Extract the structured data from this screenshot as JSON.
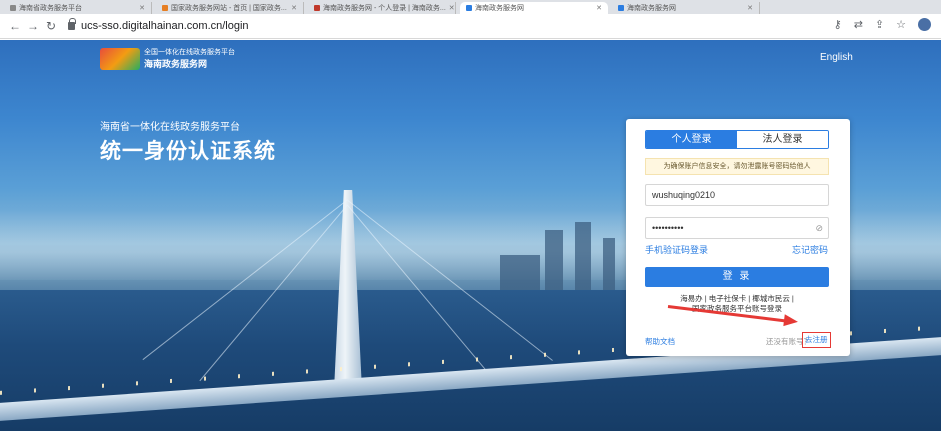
{
  "browser": {
    "tabs": [
      {
        "label": "海南省政务服务平台",
        "active": false
      },
      {
        "label": "国家政务服务网站 - 首页 | 国家政务...",
        "active": false
      },
      {
        "label": "海南政务服务网 - 个人登录 | 海南政务...",
        "active": false
      },
      {
        "label": "海南政务服务网",
        "active": true
      },
      {
        "label": "海南政务服务网",
        "active": false
      }
    ],
    "url": "ucs-sso.digitalhainan.com.cn/login",
    "back_icon": "back-arrow-icon",
    "forward_icon": "forward-arrow-icon",
    "reload_icon": "reload-icon"
  },
  "header": {
    "logo_line1": "全国一体化在线政务服务平台",
    "logo_line2": "海南政务服务网",
    "language": "English"
  },
  "hero": {
    "subtitle": "海南省一体化在线政务服务平台",
    "title": "统一身份认证系统"
  },
  "login": {
    "tabs": [
      {
        "label": "个人登录",
        "active": true
      },
      {
        "label": "法人登录",
        "active": false
      }
    ],
    "notice": "为确保账户信息安全，请勿泄露账号密码给他人",
    "username_value": "wushuqing0210",
    "password_value": "••••••••••",
    "sms_login_link": "手机验证码登录",
    "forgot_password_link": "忘记密码",
    "login_button": "登 录",
    "alt_login_line1": "海易办 | 电子社保卡 | 椰城市民云 |",
    "alt_login_line2": "国家政务服务平台账号登录",
    "help_link": "帮助文档",
    "no_account_text": "还没有账号？",
    "register_link": "去注册"
  },
  "colors": {
    "accent": "#2b7de1",
    "highlight": "#e53935"
  }
}
